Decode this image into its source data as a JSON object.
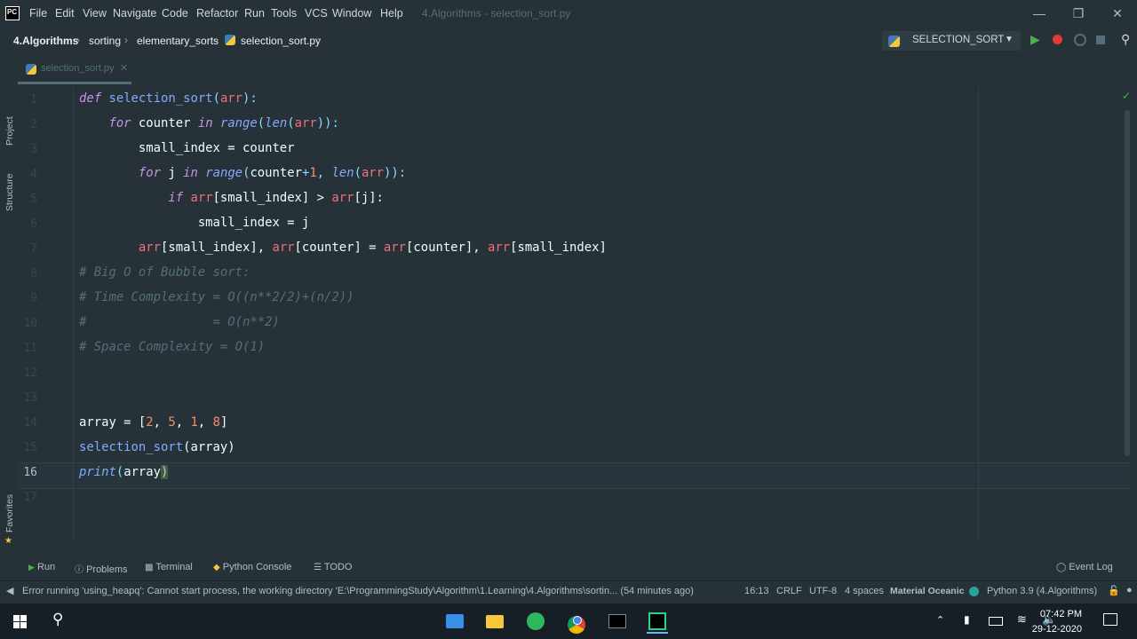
{
  "app": {
    "logo_text": "PC",
    "window_title": "4.Algorithms - selection_sort.py",
    "menu": [
      "File",
      "Edit",
      "View",
      "Navigate",
      "Code",
      "Refactor",
      "Run",
      "Tools",
      "VCS",
      "Window",
      "Help"
    ]
  },
  "breadcrumb": [
    "4.Algorithms",
    "sorting",
    "elementary_sorts",
    "selection_sort.py"
  ],
  "run_config": {
    "label": "SELECTION_SORT"
  },
  "tab": {
    "label": "selection_sort.py"
  },
  "side_tools": {
    "project": "Project",
    "structure": "Structure",
    "favorites": "Favorites"
  },
  "line_numbers": [
    "1",
    "2",
    "3",
    "4",
    "5",
    "6",
    "7",
    "8",
    "9",
    "10",
    "11",
    "12",
    "13",
    "14",
    "15",
    "16",
    "17"
  ],
  "current_line": "16",
  "code": {
    "l1": {
      "kw": "def",
      "fn": "selection_sort",
      "p1": "(",
      "arg": "arr",
      "p2": "):"
    },
    "l2": {
      "kw": "for",
      "v": "counter",
      "kw2": "in",
      "bi": "range",
      "p1": "(",
      "bi2": "len",
      "p2": "(",
      "arg": "arr",
      "p3": ")):"
    },
    "l3": {
      "t": "small_index = counter"
    },
    "l4": {
      "kw": "for",
      "v": "j",
      "kw2": "in",
      "bi": "range",
      "p1": "(",
      "v2": "counter",
      "op": "+",
      "n": "1",
      "p2": ", ",
      "bi2": "len",
      "p3": "(",
      "arg": "arr",
      "p4": ")):"
    },
    "l5": {
      "kw": "if",
      "arr1": "arr",
      "t1": "[small_index] > ",
      "arr2": "arr",
      "t2": "[j]:"
    },
    "l6": {
      "t": "small_index = j"
    },
    "l7": {
      "a1": "arr",
      "t1": "[small_index], ",
      "a2": "arr",
      "t2": "[counter] = ",
      "a3": "arr",
      "t3": "[counter], ",
      "a4": "arr",
      "t4": "[small_index]"
    },
    "l8": "# Big O of Bubble sort:",
    "l9": "# Time Complexity = O((n**2/2)+(n/2))",
    "l10": "#                 = O(n**2)",
    "l11": "# Space Complexity = O(1)",
    "l14": {
      "t1": "array = [",
      "n1": "2",
      "c1": ", ",
      "n2": "5",
      "c2": ", ",
      "n3": "1",
      "c3": ", ",
      "n4": "8",
      "t2": "]"
    },
    "l15": {
      "fn": "selection_sort",
      "t": "(array)"
    },
    "l16": {
      "bi": "print",
      "p1": "(",
      "t": "array",
      "p2": ")"
    }
  },
  "bottom_tools": [
    "Run",
    "Problems",
    "Terminal",
    "Python Console",
    "TODO",
    "Event Log"
  ],
  "status": {
    "message": "Error running 'using_heapq': Cannot start process, the working directory 'E:\\ProgrammingStudy\\Algorithm\\1.Learning\\4.Algorithms\\sortin... (54 minutes ago)",
    "position": "16:13",
    "line_sep": "CRLF",
    "encoding": "UTF-8",
    "indent": "4 spaces",
    "theme": "Material Oceanic",
    "interpreter": "Python 3.9 (4.Algorithms)"
  },
  "taskbar": {
    "time": "07:42 PM",
    "date": "29-12-2020"
  },
  "colors": {
    "bg": "#263238",
    "keyword": "#c792ea",
    "function": "#82aaff",
    "number": "#f78c6c",
    "param": "#f07178",
    "comment": "#546e7a",
    "run_green": "#4caf50",
    "debug_red": "#e53935"
  },
  "icons": [
    "pycharm-logo-icon",
    "python-file-icon",
    "python-icon",
    "run-icon",
    "debug-icon",
    "coverage-icon",
    "stop-icon",
    "search-icon",
    "close-icon",
    "checkmark-icon",
    "windows-start-icon",
    "search-taskbar-icon",
    "folder-icon",
    "chrome-icon",
    "terminal-icon",
    "notification-icon"
  ]
}
